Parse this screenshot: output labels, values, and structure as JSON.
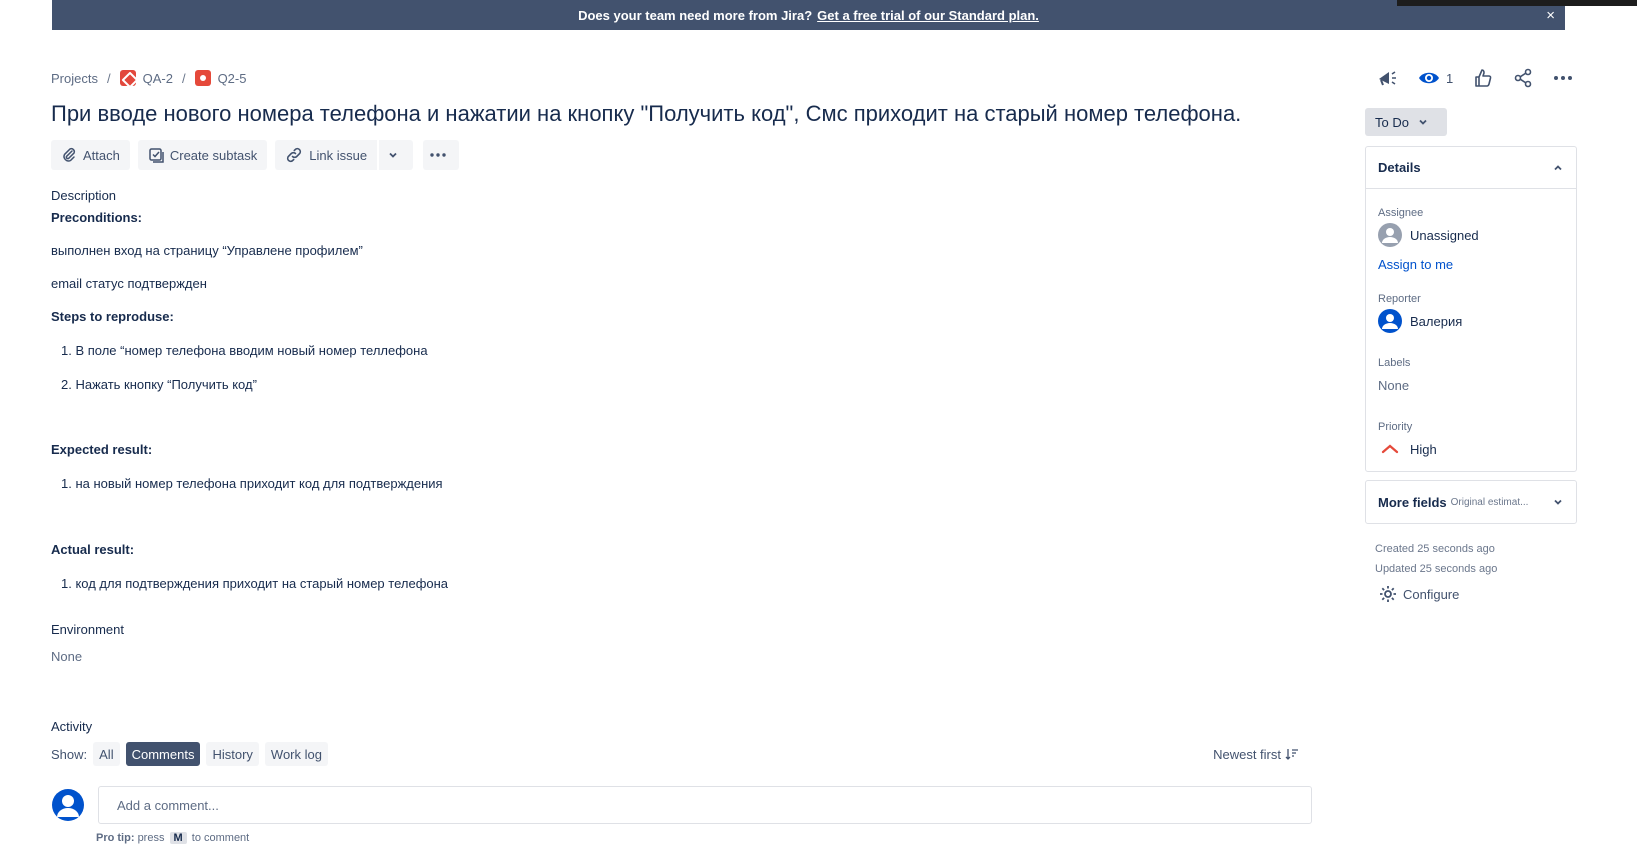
{
  "banner": {
    "text": "Does your team need more from Jira?",
    "link": "Get a free trial of our Standard plan.",
    "close": "×"
  },
  "breadcrumb": {
    "projects": "Projects",
    "separator": "/",
    "project_key": "QA-2",
    "issue_key": "Q2-5"
  },
  "issue": {
    "title": "При вводе нового номера телефона и нажатии на кнопку \"Получить код\", Смс приходит на старый номер телефона."
  },
  "toolbar": {
    "attach": "Attach",
    "create_subtask": "Create subtask",
    "link_issue": "Link issue"
  },
  "description": {
    "label": "Description",
    "preconditions_heading": "Preconditions:",
    "precondition_1": "выполнен вход на страницу “Управлене профилем”",
    "precondition_2": "email статус подтвержден",
    "steps_heading": "Steps to reproduse:",
    "step_1": "1. В поле “номер телефона вводим новый номер теллефона",
    "step_2": "2. Нажать кнопку “Получить код”",
    "expected_heading": "Expected result:",
    "expected_1": "1. на новый номер телефона приходит код для подтверждения",
    "actual_heading": "Actual result:",
    "actual_1": "1. код для подтверждения приходит на старый номер телефона"
  },
  "environment": {
    "label": "Environment",
    "value": "None"
  },
  "activity": {
    "label": "Activity",
    "show_label": "Show:",
    "filters": [
      "All",
      "Comments",
      "History",
      "Work log"
    ],
    "active_filter": "Comments",
    "sort": "Newest first",
    "comment_placeholder": "Add a comment...",
    "protip_prefix": "Pro tip:",
    "protip_press": "press",
    "protip_key": "M",
    "protip_suffix": "to comment"
  },
  "top_actions": {
    "watch_count": "1",
    "icons": [
      "megaphone-icon",
      "eye-icon",
      "thumbs-up-icon",
      "share-icon",
      "more-icon"
    ]
  },
  "status": {
    "label": "To Do"
  },
  "details": {
    "heading": "Details",
    "assignee_label": "Assignee",
    "assignee_value": "Unassigned",
    "assign_to_me": "Assign to me",
    "reporter_label": "Reporter",
    "reporter_value": "Валерия",
    "labels_label": "Labels",
    "labels_value": "None",
    "priority_label": "Priority",
    "priority_value": "High",
    "priority_color": "#e5493a"
  },
  "more_fields": {
    "title": "More fields",
    "subtitle": "Original estimat..."
  },
  "meta": {
    "created": "Created 25 seconds ago",
    "updated": "Updated 25 seconds ago",
    "configure": "Configure"
  },
  "colors": {
    "banner_bg": "#42526e",
    "link": "#0052cc",
    "avatar": "#0052cc"
  }
}
